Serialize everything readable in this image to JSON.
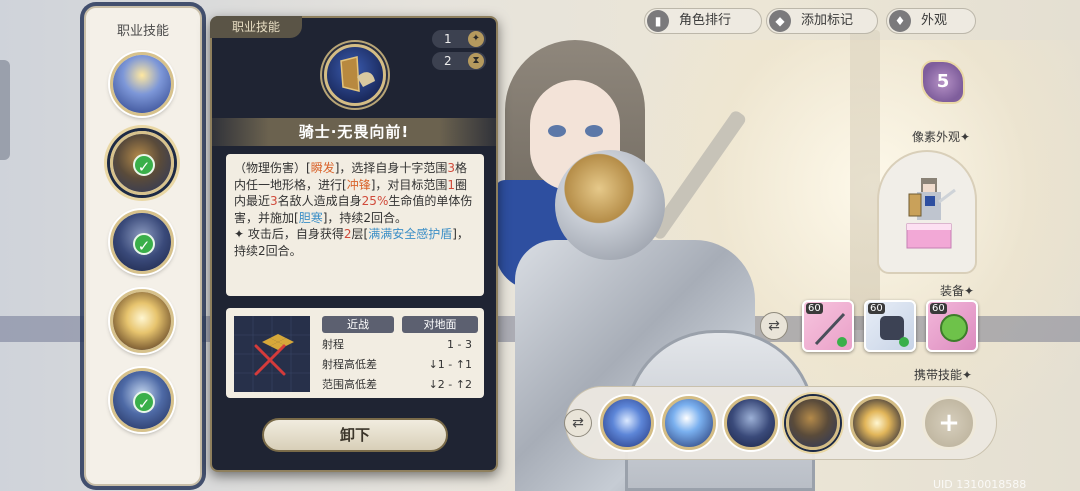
{
  "left_panel": {
    "title": "职业技能"
  },
  "tooltip": {
    "tag": "职业技能",
    "cost_1": "1",
    "cost_2": "2",
    "skill_name": "骑士·无畏向前!",
    "desc": {
      "p1_a": "（物理伤害）[",
      "p1_b": "瞬发",
      "p1_c": "]，选择自身十字范围",
      "p1_d": "3",
      "p1_e": "格内任一地形格，进行[",
      "p1_f": "冲锋",
      "p1_g": "]，对目标范围",
      "p1_h": "1",
      "p1_i": "圈内最近",
      "p1_j": "3",
      "p1_k": "名敌人造成自身",
      "p1_l": "25%",
      "p1_m": "生命值的单体伤害，并施加[",
      "p1_n": "胆寒",
      "p1_o": "]，持续2回合。",
      "p2_a": "✦ 攻击后，自身获得",
      "p2_b": "2",
      "p2_c": "层[",
      "p2_d": "满满安全感护盾",
      "p2_e": "]，持续2回合。"
    },
    "stats": {
      "head_1": "近战",
      "head_2": "对地面",
      "range_label": "射程",
      "range_value": "1 - 3",
      "range_height_label": "射程高低差",
      "range_height_value": "↓1 - ↑1",
      "area_height_label": "范围高低差",
      "area_height_value": "↓2 - ↑2"
    },
    "unequip": "卸下"
  },
  "top_buttons": {
    "ranking": "角色排行",
    "add_mark": "添加标记",
    "appearance": "外观"
  },
  "right_panel": {
    "level": "5",
    "pixel_label": "像素外观✦",
    "equip_label": "装备✦",
    "carry_label": "携带技能✦",
    "gear_levels": [
      "60",
      "60",
      "60"
    ]
  },
  "bottom_bar": {
    "add": "+"
  },
  "uid": "UID 1310018588",
  "icons": {
    "swap": "swap-arrows-icon",
    "cost_1": "compass-star-icon",
    "cost_2": "hourglass-icon"
  },
  "colors": {
    "panel_dark": "#1f2433",
    "accent_gold": "#d4bd85",
    "highlight_orange": "#d9642c",
    "highlight_blue": "#3c8fc7",
    "check_green": "#3aaf4a"
  }
}
